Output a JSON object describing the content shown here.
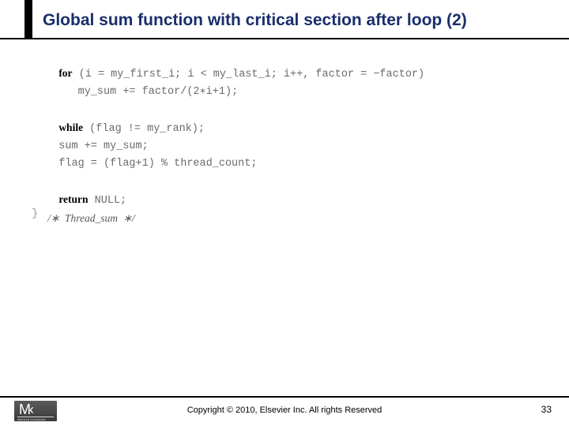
{
  "title": "Global sum function with critical section after loop (2)",
  "code": {
    "l1_kw": "for",
    "l1_rest": " (i = my_first_i; i < my_last_i; i++, factor = −factor)",
    "l2": "      my_sum += factor/(2∗i+1);",
    "l3_kw": "while",
    "l3_rest": " (flag != my_rank);",
    "l4": "   sum += my_sum;",
    "l5": "   flag = (flag+1) % thread_count;",
    "l6_kw": "return",
    "l6_rest": " NULL;",
    "l7_brace": "}",
    "l7_comment": "   /∗  Thread_sum  ∗/"
  },
  "footer": {
    "copyright": "Copyright © 2010, Elsevier Inc. All rights Reserved",
    "page": "33",
    "logo_main": "M‹",
    "logo_sub": "MORGAN KAUFMANN"
  }
}
